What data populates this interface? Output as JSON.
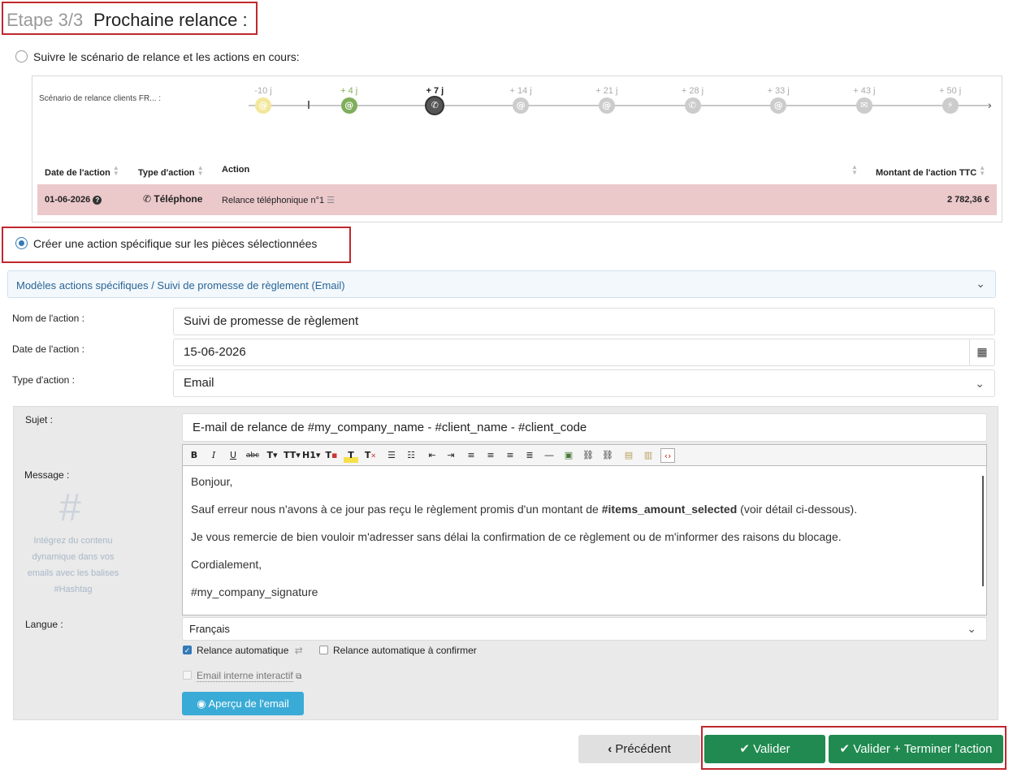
{
  "header": {
    "step": "Etape 3/3",
    "title": "Prochaine relance :"
  },
  "option1": {
    "label": "Suivre le scénario de relance et les actions en cours:"
  },
  "scenario": {
    "label": "Scénario de relance clients FR... :",
    "steps": [
      {
        "day": "-10 j",
        "icon": "at-icon",
        "color": "#f2e79a",
        "state": "past"
      },
      {
        "day": "+ 4 j",
        "icon": "at-icon",
        "color": "#7fae5c",
        "state": "done"
      },
      {
        "day": "+ 7 j",
        "icon": "phone-icon",
        "color": "#555555",
        "state": "current"
      },
      {
        "day": "+ 14 j",
        "icon": "at-icon",
        "color": "#cccccc",
        "state": "future"
      },
      {
        "day": "+ 21 j",
        "icon": "at-icon",
        "color": "#cccccc",
        "state": "future"
      },
      {
        "day": "+ 28 j",
        "icon": "phone-icon",
        "color": "#cccccc",
        "state": "future"
      },
      {
        "day": "+ 33 j",
        "icon": "at-icon",
        "color": "#cccccc",
        "state": "future"
      },
      {
        "day": "+ 43 j",
        "icon": "mail-icon",
        "color": "#cccccc",
        "state": "future"
      },
      {
        "day": "+ 50 j",
        "icon": "bolt-icon",
        "color": "#cccccc",
        "state": "future"
      }
    ],
    "table": {
      "headers": {
        "date": "Date de l'action",
        "type": "Type d'action",
        "action": "Action",
        "amount": "Montant de l'action TTC"
      },
      "row": {
        "date": "01-06-2026",
        "type": "Téléphone",
        "action": "Relance téléphonique n°1",
        "amount": "2 782,36 €"
      }
    }
  },
  "option2": {
    "label": "Créer une action spécifique sur les pièces sélectionnées"
  },
  "templates": {
    "label": "Modèles actions spécifiques / Suivi de promesse de règlement (Email)"
  },
  "form": {
    "name_label": "Nom de l'action :",
    "name_value": "Suivi de promesse de règlement",
    "date_label": "Date de l'action :",
    "date_value": "15-06-2026",
    "type_label": "Type d'action :",
    "type_value": "Email"
  },
  "email": {
    "subject_label": "Sujet :",
    "subject_value": "E-mail de relance de #my_company_name - #client_name - #client_code",
    "message_label": "Message :",
    "hashtag_symbol": "#",
    "hashtag_help": [
      "Intégrez du contenu",
      "dynamique dans vos",
      "emails avec les balises",
      "#Hashtag"
    ],
    "body": {
      "greeting": "Bonjour,",
      "p1_before": "Sauf erreur nous n'avons à ce jour pas reçu le règlement promis d'un montant de ",
      "p1_bold": "#items_amount_selected",
      "p1_after": " (voir détail ci-dessous).",
      "p2": "Je vous remercie de bien vouloir m'adresser sans délai la confirmation de ce règlement ou de m'informer des raisons du blocage.",
      "closing": "Cordialement,",
      "signature": "#my_company_signature"
    },
    "language_label": "Langue :",
    "language_value": "Français",
    "auto_label": "Relance automatique",
    "auto_confirm_label": "Relance automatique à confirmer",
    "internal_label": "Email interne interactif",
    "preview_label": "Aperçu de l'email"
  },
  "footer": {
    "prev_label": "Précédent",
    "validate_label": "Valider",
    "validate_finish_label": "Valider + Terminer l'action"
  },
  "colors": {
    "accent": "#337ab7",
    "green": "#208a50",
    "highlight": "#c0282d",
    "row": "#ebc8ca"
  }
}
